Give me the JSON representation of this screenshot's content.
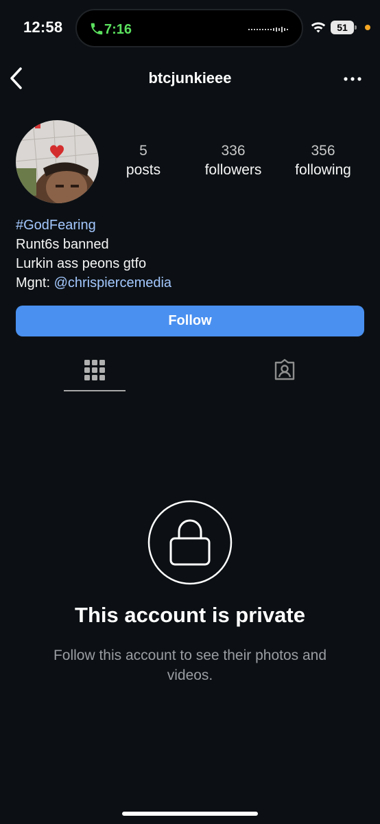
{
  "status_bar": {
    "time": "12:58",
    "call_timer": "7:16",
    "battery": "51",
    "icons": [
      "phone-icon",
      "wifi-icon",
      "battery-icon"
    ]
  },
  "header": {
    "username": "btcjunkieee",
    "back_icon": "chevron-left-icon",
    "more_icon": "more-horizontal-icon"
  },
  "profile": {
    "stats": [
      {
        "count": "5",
        "label": "posts"
      },
      {
        "count": "336",
        "label": "followers"
      },
      {
        "count": "356",
        "label": "following"
      }
    ],
    "bio": {
      "hashtag": "#GodFearing",
      "line2": "Runt6s banned",
      "line3": "Lurkin ass peons gtfo",
      "mgmt_prefix": "Mgnt: ",
      "mention": "@chrispiercemedia"
    }
  },
  "actions": {
    "follow_label": "Follow"
  },
  "tabs": [
    {
      "icon": "grid-icon",
      "active": true
    },
    {
      "icon": "tagged-icon",
      "active": false
    }
  ],
  "private": {
    "title": "This account is private",
    "description": "Follow this account to see their photos and videos."
  },
  "colors": {
    "background": "#0c1014",
    "accent": "#4a90f0",
    "link": "#a4c8ff",
    "call_green": "#5be05e"
  }
}
